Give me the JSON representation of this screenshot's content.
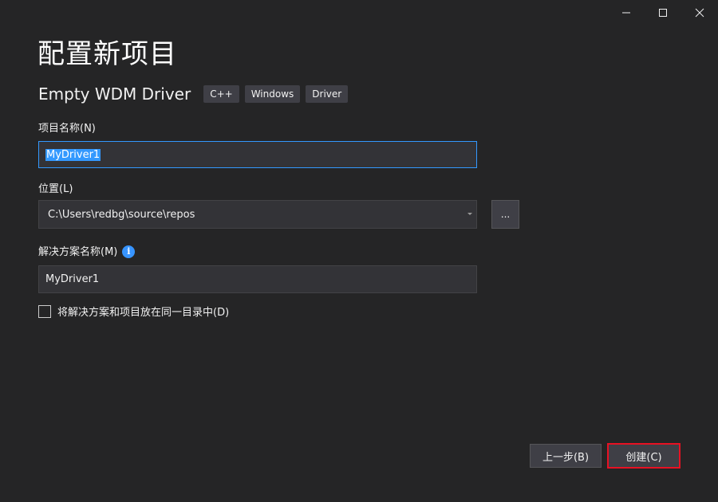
{
  "window": {
    "title": "配置新项目"
  },
  "template": {
    "name": "Empty WDM Driver",
    "tags": [
      "C++",
      "Windows",
      "Driver"
    ]
  },
  "form": {
    "project_name_label": "项目名称(N)",
    "project_name_value": "MyDriver1",
    "location_label": "位置(L)",
    "location_value": "C:\\Users\\redbg\\source\\repos",
    "browse_label": "...",
    "solution_name_label": "解决方案名称(M)",
    "solution_name_value": "MyDriver1",
    "same_dir_checkbox_label": "将解决方案和项目放在同一目录中(D)",
    "same_dir_checked": false
  },
  "buttons": {
    "back_label": "上一步(B)",
    "create_label": "创建(C)"
  },
  "colors": {
    "background": "#252526",
    "accent_blue": "#3399ff",
    "highlight_red": "#e81123"
  }
}
